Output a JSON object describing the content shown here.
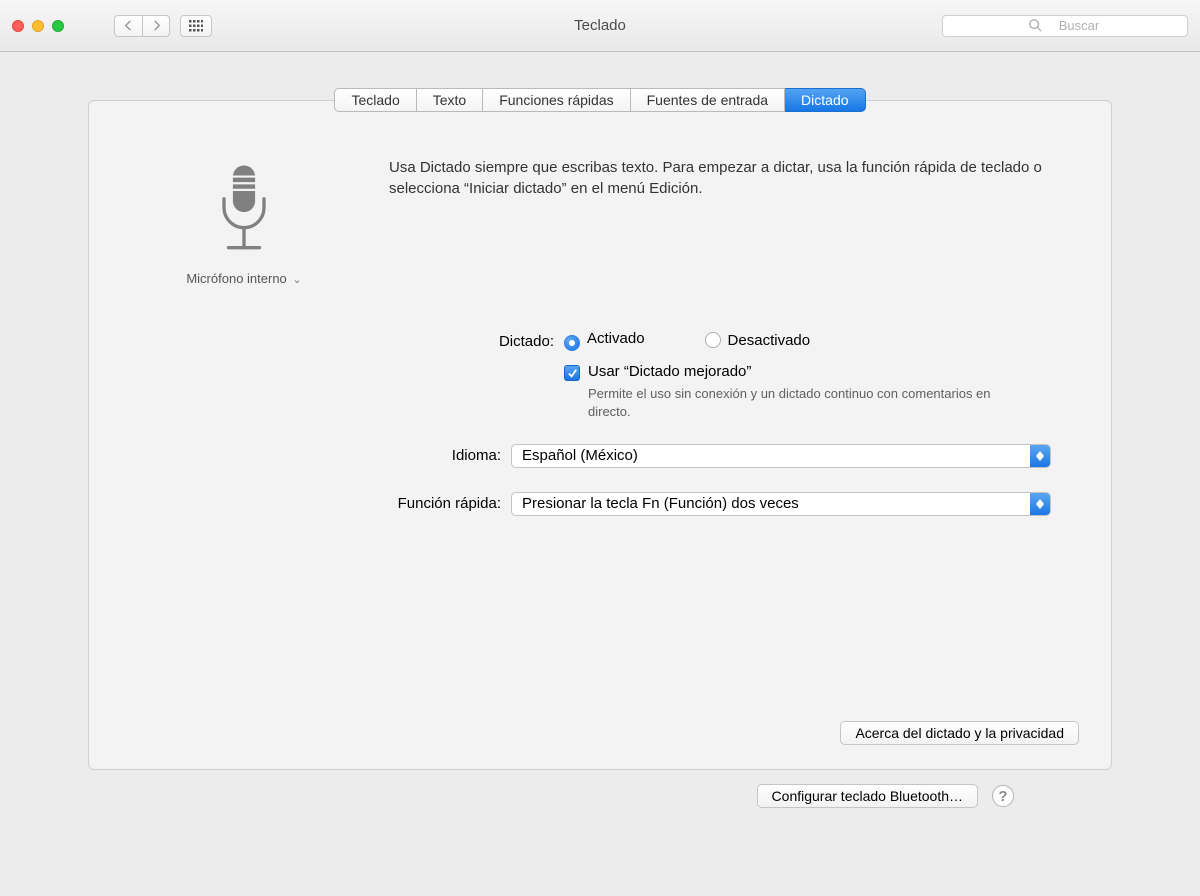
{
  "window": {
    "title": "Teclado",
    "search_placeholder": "Buscar"
  },
  "tabs": [
    {
      "label": "Teclado"
    },
    {
      "label": "Texto"
    },
    {
      "label": "Funciones rápidas"
    },
    {
      "label": "Fuentes de entrada"
    },
    {
      "label": "Dictado"
    }
  ],
  "mic": {
    "label": "Micrófono interno"
  },
  "description": "Usa Dictado siempre que escribas texto. Para empezar a dictar, usa la función rápida de teclado o selecciona “Iniciar dictado” en el menú Edición.",
  "dictation": {
    "label": "Dictado:",
    "on": "Activado",
    "off": "Desactivado",
    "enhanced": "Usar “Dictado mejorado”",
    "enhanced_desc": "Permite el uso sin conexión y un dictado continuo con comentarios en directo."
  },
  "language": {
    "label": "Idioma:",
    "value": "Español (México)"
  },
  "shortcut": {
    "label": "Función rápida:",
    "value": "Presionar la tecla Fn (Función) dos veces"
  },
  "about_btn": "Acerca del dictado y la privacidad",
  "bluetooth_btn": "Configurar teclado Bluetooth…",
  "help": "?"
}
